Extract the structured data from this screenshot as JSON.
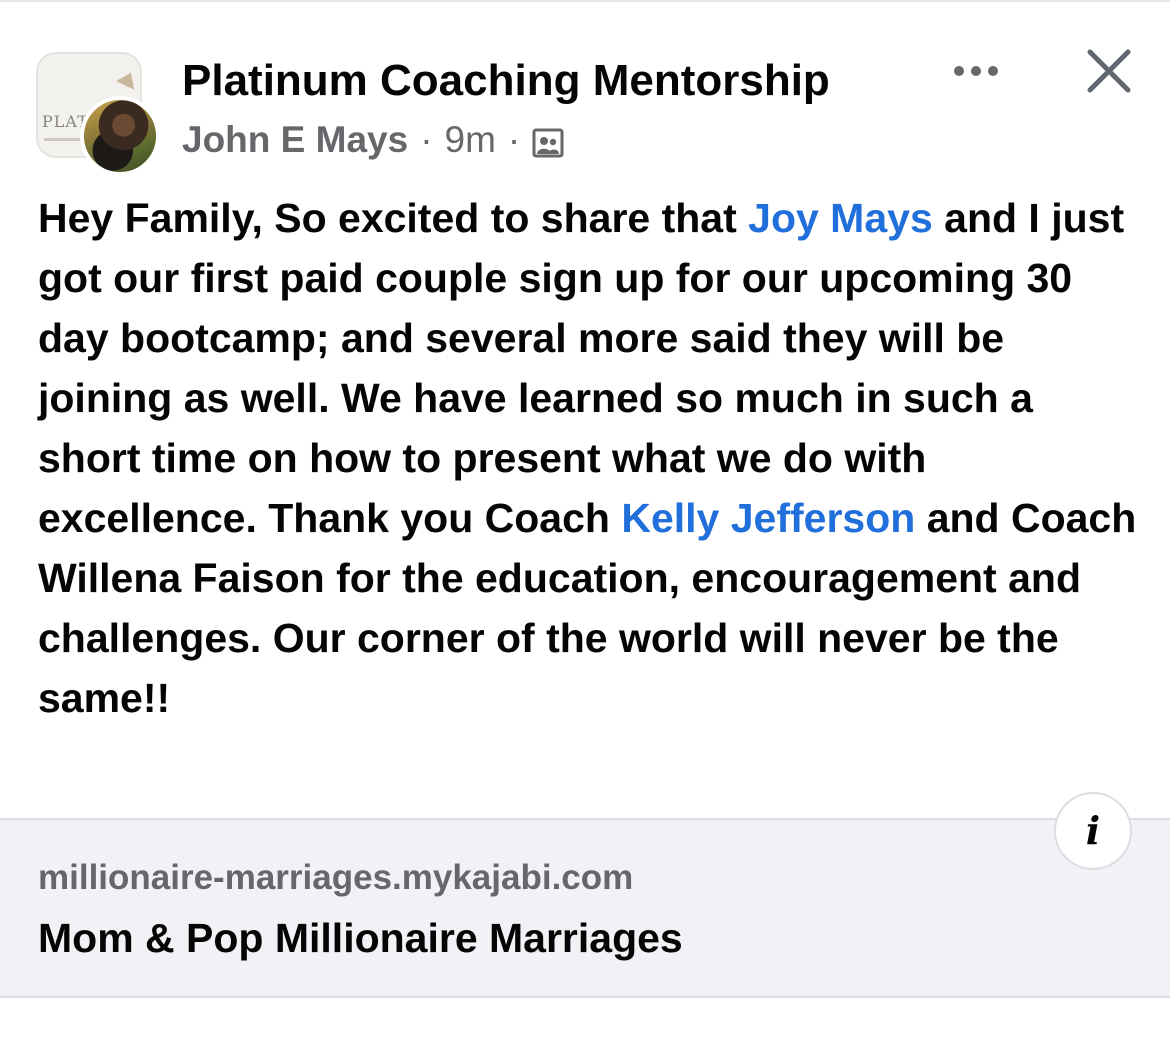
{
  "header": {
    "group_name": "Platinum Coaching Mentorship",
    "author": "John E Mays",
    "separator": "·",
    "time": "9m",
    "group_logo_text": "PLAT",
    "audience_icon": "group-members-icon",
    "more_icon": "more-options-icon",
    "close_icon": "close-icon"
  },
  "post": {
    "segments": [
      {
        "text": "Hey Family,  So excited to share that ",
        "type": "text"
      },
      {
        "text": "Joy Mays",
        "type": "mention"
      },
      {
        "text": " and I just got our first paid couple sign up for our upcoming 30 day bootcamp; and several more said they will be joining as well. We have learned so much in such a short time on how to present what we do with excellence.  Thank you Coach ",
        "type": "text"
      },
      {
        "text": "Kelly Jefferson",
        "type": "mention"
      },
      {
        "text": " and Coach Willena Faison for the education, encouragement and challenges. Our corner of the world will never be the same!!",
        "type": "text"
      }
    ]
  },
  "link_preview": {
    "domain": "millionaire-marriages.mykajabi.com",
    "title": "Mom & Pop Millionaire Marriages",
    "info_icon": "info-icon",
    "info_glyph": "i"
  },
  "colors": {
    "mention": "#216fdb",
    "secondary_text": "#65676b",
    "preview_bg": "#f0f2f5"
  }
}
